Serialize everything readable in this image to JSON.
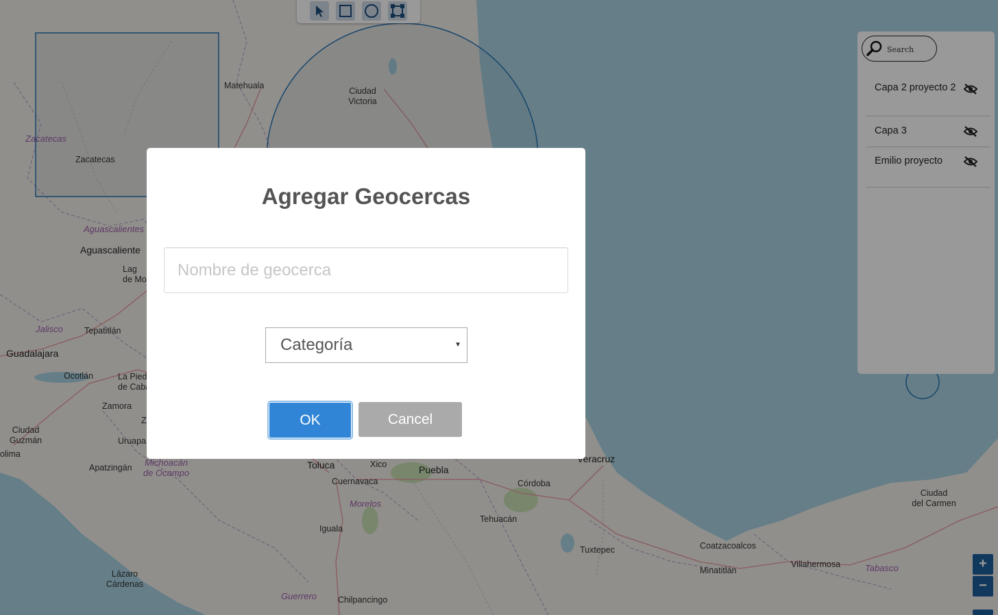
{
  "map": {
    "places": [
      {
        "id": "matehuala",
        "label": "Matehuala",
        "type": "town"
      },
      {
        "id": "ciudad-victoria",
        "label": "Ciudad\nVictoria",
        "type": "town"
      },
      {
        "id": "zacatecas-state",
        "label": "Zacatecas",
        "type": "state"
      },
      {
        "id": "zacatecas",
        "label": "Zacatecas",
        "type": "town"
      },
      {
        "id": "aguascalientes-state",
        "label": "Aguascalientes",
        "type": "state"
      },
      {
        "id": "aguascalientes",
        "label": "Aguascaliente",
        "type": "city"
      },
      {
        "id": "lagos",
        "label": "Lag\nde Mo",
        "type": "town"
      },
      {
        "id": "jalisco-state",
        "label": "Jalisco",
        "type": "state"
      },
      {
        "id": "tepatitlan",
        "label": "Tepatitlán",
        "type": "town"
      },
      {
        "id": "guadalajara",
        "label": "Guadalajara",
        "type": "city"
      },
      {
        "id": "ocotlan",
        "label": "Ocotlán",
        "type": "town"
      },
      {
        "id": "la-piedad",
        "label": "La Pied\nde Caba",
        "type": "town"
      },
      {
        "id": "zamora",
        "label": "Zamora",
        "type": "town"
      },
      {
        "id": "z-label",
        "label": "Z",
        "type": "town"
      },
      {
        "id": "ciudad-guzman",
        "label": "Ciudad\nGuzmán",
        "type": "town"
      },
      {
        "id": "uruapan",
        "label": "Uruapa",
        "type": "town"
      },
      {
        "id": "colima",
        "label": "olima",
        "type": "town"
      },
      {
        "id": "apatzingan",
        "label": "Apatzingán",
        "type": "town"
      },
      {
        "id": "michoacan-state",
        "label": "Michoacán\nde Ocampo",
        "type": "state"
      },
      {
        "id": "toluca",
        "label": "Toluca",
        "type": "city"
      },
      {
        "id": "xico",
        "label": "Xico",
        "type": "town"
      },
      {
        "id": "puebla",
        "label": "Puebla",
        "type": "city"
      },
      {
        "id": "cuernavaca",
        "label": "Cuernavaca",
        "type": "town"
      },
      {
        "id": "morelos-state",
        "label": "Morelos",
        "type": "state"
      },
      {
        "id": "cordoba",
        "label": "Córdoba",
        "type": "town"
      },
      {
        "id": "veracruz",
        "label": "Veracruz",
        "type": "city"
      },
      {
        "id": "iguala",
        "label": "Iguala",
        "type": "town"
      },
      {
        "id": "tehuacan",
        "label": "Tehuacán",
        "type": "town"
      },
      {
        "id": "tuxtepec",
        "label": "Tuxtepec",
        "type": "town"
      },
      {
        "id": "coatzacoalcos",
        "label": "Coatzacoalcos",
        "type": "town"
      },
      {
        "id": "minatitlan",
        "label": "Minatitlán",
        "type": "town"
      },
      {
        "id": "villahermosa",
        "label": "Villahermosa",
        "type": "town"
      },
      {
        "id": "tabasco-state",
        "label": "Tabasco",
        "type": "state"
      },
      {
        "id": "ciudad-del-carmen",
        "label": "Ciudad\ndel Carmen",
        "type": "town"
      },
      {
        "id": "lazaro-cardenas",
        "label": "Lázaro\nCárdenas",
        "type": "town"
      },
      {
        "id": "guerrero-state",
        "label": "Guerrero",
        "type": "state"
      },
      {
        "id": "chilpancingo",
        "label": "Chilpancingo",
        "type": "town"
      }
    ]
  },
  "draw_toolbar": {
    "tools": [
      {
        "name": "select-tool",
        "icon": "pointer-icon"
      },
      {
        "name": "rectangle-tool",
        "icon": "square-icon"
      },
      {
        "name": "circle-tool",
        "icon": "circle-icon"
      },
      {
        "name": "polygon-tool",
        "icon": "polygon-icon"
      }
    ]
  },
  "layers_panel": {
    "search_placeholder": "Search",
    "layers": [
      {
        "label": "Capa 2 proyecto 2",
        "icon": "eye-slash-icon"
      },
      {
        "label": "Capa 3",
        "icon": "eye-slash-icon"
      },
      {
        "label": "Emilio proyecto",
        "icon": "eye-slash-icon"
      }
    ]
  },
  "zoom": {
    "in_label": "+",
    "out_label": "−"
  },
  "dialog": {
    "title": "Agregar Geocercas",
    "name_placeholder": "Nombre de geocerca",
    "name_value": "",
    "category_selected": "Categoría",
    "ok_label": "OK",
    "cancel_label": "Cancel"
  },
  "colors": {
    "sea": "#a9d3e3",
    "land": "#f2efe9",
    "geofence_stroke": "#2673b5",
    "ok_button": "#3085d6",
    "cancel_button": "#aaaaaa",
    "zoom_button": "#1d5f9c"
  }
}
